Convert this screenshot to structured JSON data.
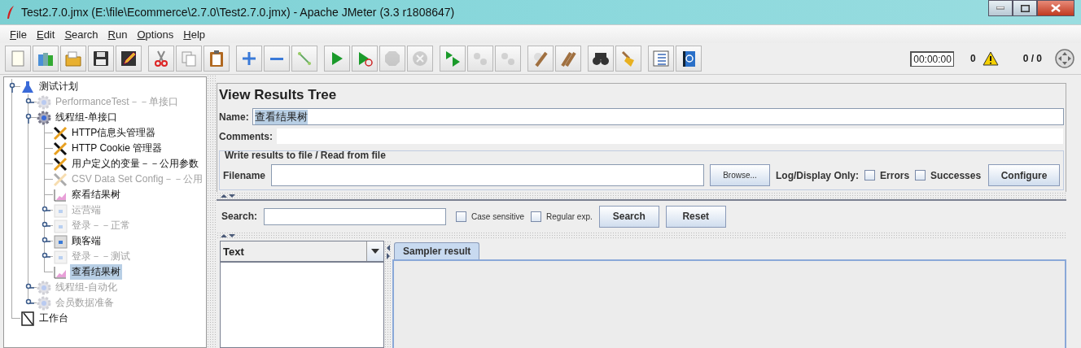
{
  "window": {
    "title": "Test2.7.0.jmx (E:\\file\\Ecommerce\\2.7.0\\Test2.7.0.jmx) - Apache JMeter (3.3 r1808647)"
  },
  "menu": [
    "File",
    "Edit",
    "Search",
    "Run",
    "Options",
    "Help"
  ],
  "toolbar": [
    [
      {
        "kind": "new",
        "disabled": false
      },
      {
        "kind": "templates",
        "disabled": false
      },
      {
        "kind": "open",
        "disabled": false
      },
      {
        "kind": "save",
        "disabled": false
      },
      {
        "kind": "save-as",
        "disabled": false
      }
    ],
    [
      {
        "kind": "cut",
        "disabled": false
      },
      {
        "kind": "copy",
        "disabled": false
      },
      {
        "kind": "paste",
        "disabled": false
      }
    ],
    [
      {
        "kind": "expand",
        "disabled": false
      },
      {
        "kind": "collapse",
        "disabled": false
      },
      {
        "kind": "toggle",
        "disabled": false
      }
    ],
    [
      {
        "kind": "start",
        "disabled": false
      },
      {
        "kind": "start-no-pause",
        "disabled": false
      },
      {
        "kind": "stop",
        "disabled": true
      },
      {
        "kind": "shutdown",
        "disabled": true
      }
    ],
    [
      {
        "kind": "remote-start",
        "disabled": false
      },
      {
        "kind": "remote-stop",
        "disabled": true
      },
      {
        "kind": "remote-exit",
        "disabled": true
      }
    ],
    [
      {
        "kind": "clear",
        "disabled": false
      },
      {
        "kind": "clear-all",
        "disabled": false
      }
    ],
    [
      {
        "kind": "search",
        "disabled": false
      },
      {
        "kind": "reset-search",
        "disabled": false
      }
    ],
    [
      {
        "kind": "functions",
        "disabled": false
      },
      {
        "kind": "help",
        "disabled": false
      }
    ]
  ],
  "status": {
    "timer": "00:00:00",
    "errors": "0",
    "threads": "0 / 0"
  },
  "tree": [
    {
      "label": "测试计划",
      "kind": "plan",
      "disabled": false,
      "selected": false,
      "expanded": true,
      "children": [
        {
          "label": "PerformanceTest－－单接口",
          "kind": "thread-group",
          "disabled": true,
          "selected": false,
          "expanded": false
        },
        {
          "label": "线程组-单接口",
          "kind": "thread-group",
          "disabled": false,
          "selected": false,
          "expanded": true,
          "children": [
            {
              "label": "HTTP信息头管理器",
              "kind": "config",
              "disabled": false,
              "selected": false
            },
            {
              "label": "HTTP Cookie 管理器",
              "kind": "config",
              "disabled": false,
              "selected": false
            },
            {
              "label": "用户定义的变量－－公用参数",
              "kind": "config",
              "disabled": false,
              "selected": false
            },
            {
              "label": "CSV Data Set Config－－公用",
              "kind": "config",
              "disabled": true,
              "selected": false
            },
            {
              "label": "察看结果树",
              "kind": "listener",
              "disabled": false,
              "selected": false
            },
            {
              "label": "运营端",
              "kind": "controller",
              "disabled": true,
              "selected": false,
              "expanded": false
            },
            {
              "label": "登录－－正常",
              "kind": "controller",
              "disabled": true,
              "selected": false,
              "expanded": false
            },
            {
              "label": "顾客端",
              "kind": "controller",
              "disabled": false,
              "selected": false,
              "expanded": false
            },
            {
              "label": "登录－－测试",
              "kind": "controller",
              "disabled": true,
              "selected": false,
              "expanded": false
            },
            {
              "label": "查看结果树",
              "kind": "listener",
              "disabled": false,
              "selected": true
            }
          ]
        },
        {
          "label": "线程组-自动化",
          "kind": "thread-group",
          "disabled": true,
          "selected": false,
          "expanded": false
        },
        {
          "label": "会员数据准备",
          "kind": "thread-group",
          "disabled": true,
          "selected": false,
          "expanded": false
        }
      ]
    },
    {
      "label": "工作台",
      "kind": "workbench",
      "disabled": false,
      "selected": false
    }
  ],
  "panel": {
    "title": "View Results Tree",
    "name": {
      "label": "Name:",
      "value": "查看结果树",
      "highlighted": true
    },
    "comments": {
      "label": "Comments:"
    },
    "file_group": {
      "legend": "Write results to file / Read from file",
      "filename_label": "Filename",
      "browse": "Browse...",
      "log_label": "Log/Display Only:",
      "checks": [
        {
          "label": "Errors",
          "checked": false
        },
        {
          "label": "Successes",
          "checked": false
        }
      ],
      "configure": "Configure"
    },
    "search": {
      "label": "Search:",
      "options": [
        {
          "label": "Case sensitive",
          "checked": false
        },
        {
          "label": "Regular exp.",
          "checked": false
        }
      ],
      "buttons": [
        "Search",
        "Reset"
      ]
    },
    "renderer": {
      "value": "Text"
    },
    "tabs": [
      {
        "label": "Sampler result",
        "selected": true
      }
    ]
  }
}
